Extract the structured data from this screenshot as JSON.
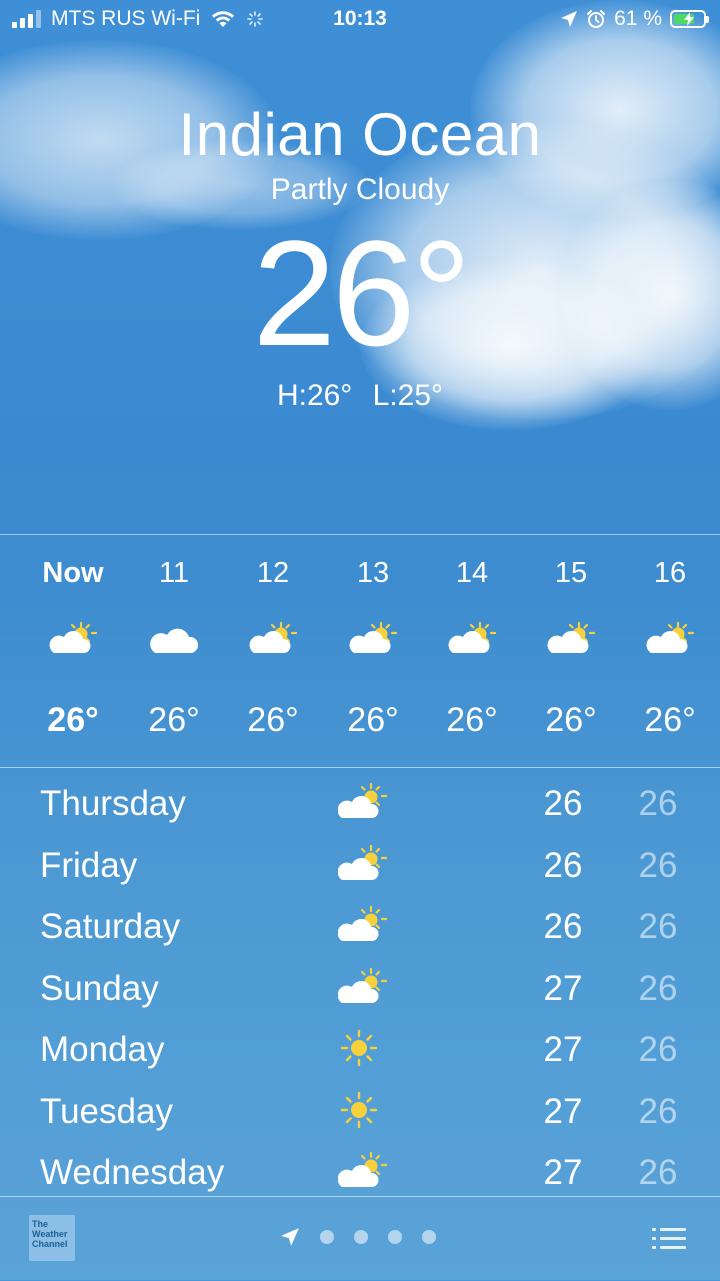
{
  "status_bar": {
    "carrier": "MTS RUS Wi-Fi",
    "time": "10:13",
    "battery": "61 %",
    "icons": [
      "signal-icon",
      "wifi-icon",
      "activity-spinner-icon",
      "location-arrow-icon",
      "alarm-icon",
      "battery-charging-icon"
    ]
  },
  "weather": {
    "location": "Indian Ocean",
    "condition": "Partly Cloudy",
    "temperature": "26°",
    "high": "H:26°",
    "low": "L:25°"
  },
  "hourly": [
    {
      "label": "Now",
      "icon": "partly-cloudy-icon",
      "temp": "26°"
    },
    {
      "label": "11",
      "icon": "cloud-icon",
      "temp": "26°"
    },
    {
      "label": "12",
      "icon": "partly-cloudy-icon",
      "temp": "26°"
    },
    {
      "label": "13",
      "icon": "partly-cloudy-icon",
      "temp": "26°"
    },
    {
      "label": "14",
      "icon": "partly-cloudy-icon",
      "temp": "26°"
    },
    {
      "label": "15",
      "icon": "partly-cloudy-icon",
      "temp": "26°"
    },
    {
      "label": "16",
      "icon": "partly-cloudy-icon",
      "temp": "26°"
    }
  ],
  "daily": [
    {
      "day": "Thursday",
      "icon": "partly-cloudy-icon",
      "high": "26",
      "low": "26"
    },
    {
      "day": "Friday",
      "icon": "partly-cloudy-icon",
      "high": "26",
      "low": "26"
    },
    {
      "day": "Saturday",
      "icon": "partly-cloudy-icon",
      "high": "26",
      "low": "26"
    },
    {
      "day": "Sunday",
      "icon": "partly-cloudy-icon",
      "high": "27",
      "low": "26"
    },
    {
      "day": "Monday",
      "icon": "sun-icon",
      "high": "27",
      "low": "26"
    },
    {
      "day": "Tuesday",
      "icon": "sun-icon",
      "high": "27",
      "low": "26"
    },
    {
      "day": "Wednesday",
      "icon": "partly-cloudy-icon",
      "high": "27",
      "low": "26"
    }
  ],
  "bottom_bar": {
    "logo_text": "The Weather Channel",
    "page_count": 4,
    "icons": [
      "weather-channel-logo",
      "location-arrow-icon",
      "page-dot",
      "list-icon"
    ]
  },
  "colors": {
    "sky_top": "#3f8fd6",
    "sky_bottom": "#5aa3d8",
    "sun": "#f7d13b",
    "text": "#ffffff",
    "low_temp": "rgba(255,255,255,0.55)"
  }
}
